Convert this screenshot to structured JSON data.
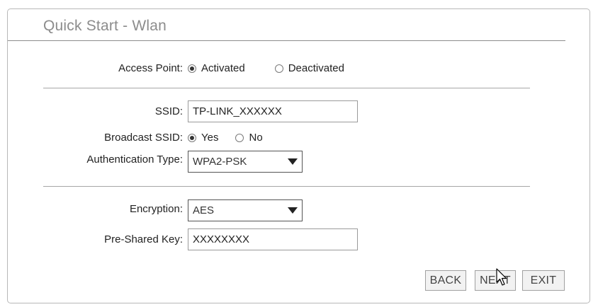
{
  "window": {
    "title": "Quick Start - Wlan"
  },
  "access_point": {
    "label": "Access Point:",
    "options": [
      {
        "label": "Activated",
        "checked": true
      },
      {
        "label": "Deactivated",
        "checked": false
      }
    ]
  },
  "ssid": {
    "label": "SSID:",
    "value": "TP-LINK_XXXXXX"
  },
  "broadcast_ssid": {
    "label": "Broadcast SSID:",
    "options": [
      {
        "label": "Yes",
        "checked": true
      },
      {
        "label": "No",
        "checked": false
      }
    ]
  },
  "authentication_type": {
    "label": "Authentication Type:",
    "selected": "WPA2-PSK"
  },
  "encryption": {
    "label": "Encryption:",
    "selected": "AES"
  },
  "pre_shared_key": {
    "label": "Pre-Shared Key:",
    "value": "XXXXXXXX"
  },
  "buttons": {
    "back": "BACK",
    "next": "NEXT",
    "exit": "EXIT"
  },
  "icons": {
    "cursor": "mouse-pointer-icon"
  }
}
